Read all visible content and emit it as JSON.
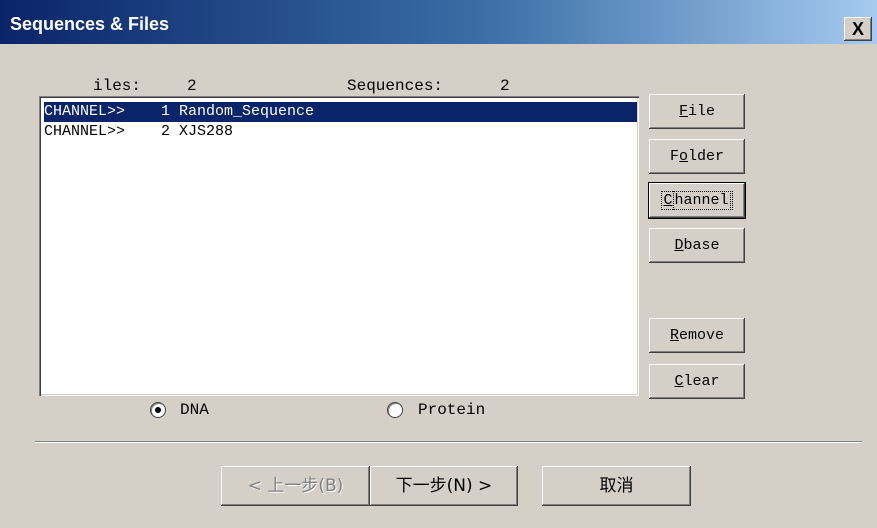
{
  "window": {
    "title": "Sequences & Files",
    "close_label": "X"
  },
  "stats": {
    "files_label": "iles:",
    "files_count": "2",
    "sequences_label": "Sequences:",
    "sequences_count": "2"
  },
  "sequence_list": [
    {
      "text": "CHANNEL>>    1 Random_Sequence",
      "selected": true
    },
    {
      "text": "CHANNEL>>    2 XJS288",
      "selected": false
    }
  ],
  "side_buttons": {
    "file": {
      "mnemonic": "F",
      "rest": "ile"
    },
    "folder": {
      "pre": "F",
      "mnemonic": "o",
      "rest": "lder"
    },
    "channel": {
      "mnemonic": "C",
      "rest": "hannel"
    },
    "dbase": {
      "mnemonic": "D",
      "rest": "base"
    },
    "remove": {
      "mnemonic": "R",
      "rest": "emove"
    },
    "clear": {
      "mnemonic": "C",
      "rest": "lear"
    }
  },
  "sequence_type": {
    "dna_label": "DNA",
    "protein_label": "Protein",
    "selected": "DNA"
  },
  "nav_buttons": {
    "back_label": "< 上一步(B)",
    "next_label": "下一步(N) >",
    "cancel_label": "取消"
  }
}
